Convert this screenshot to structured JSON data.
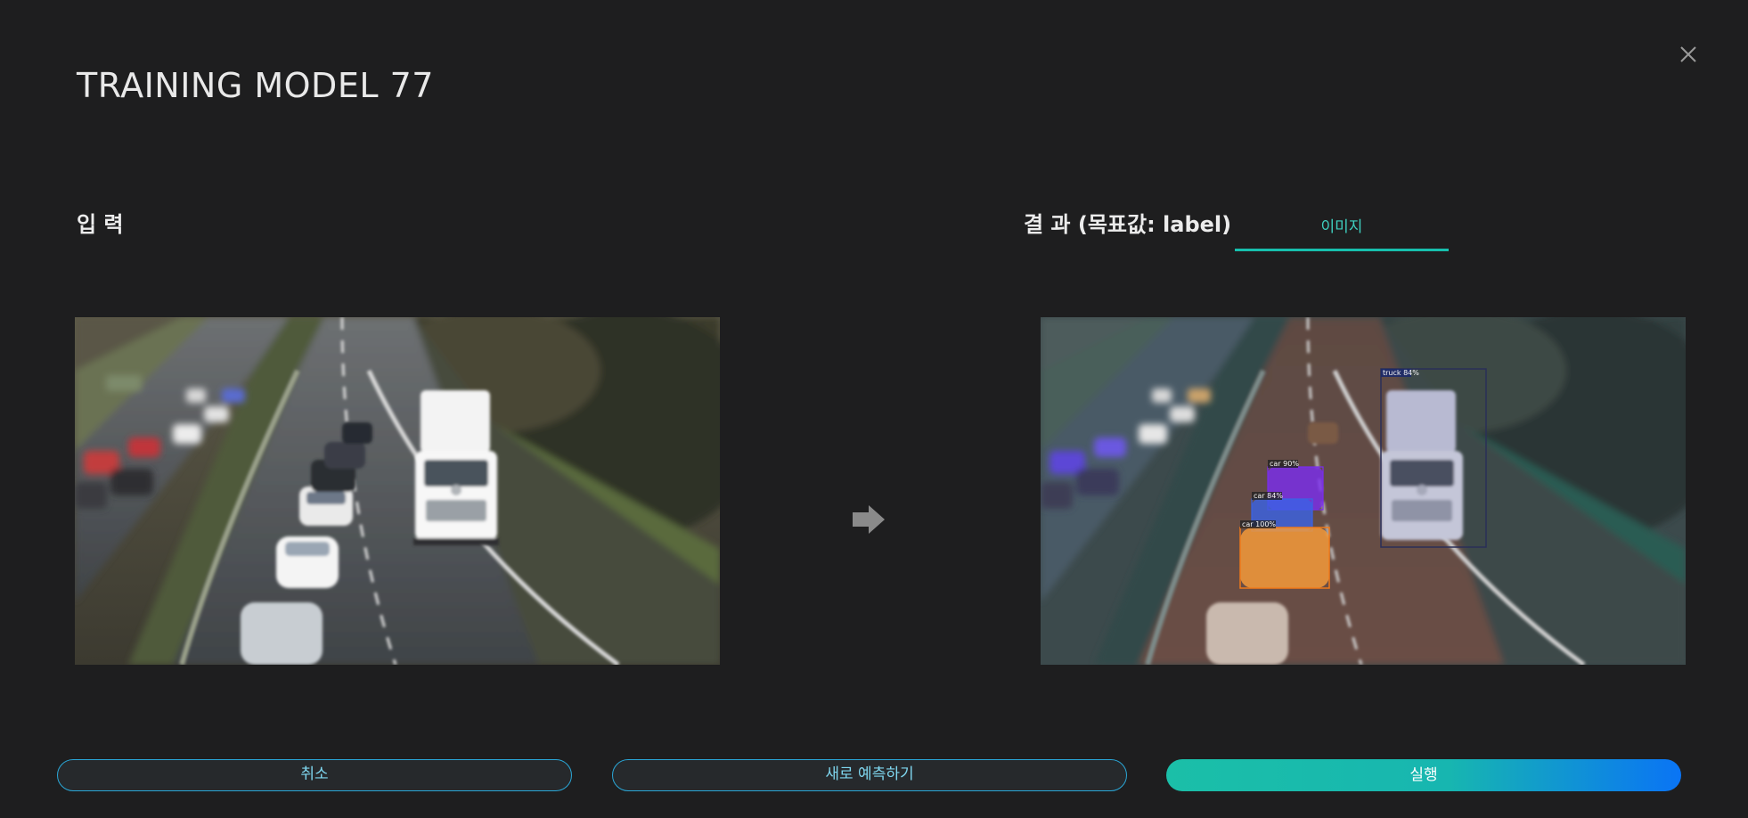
{
  "dialog": {
    "title": "TRAINING MODEL 77"
  },
  "input_section": {
    "label": "입 력"
  },
  "result_section": {
    "label": "결 과 (목표값: label)",
    "tabs": [
      {
        "label": "이미지",
        "active": true
      }
    ]
  },
  "detections": [
    {
      "label": "car 90%",
      "color": "#7b2df0"
    },
    {
      "label": "car 84%",
      "color": "#3a63e6"
    },
    {
      "label": "car 100%",
      "color": "#f59a3a"
    },
    {
      "label": "truck 84%",
      "color": "#8a90b0"
    }
  ],
  "buttons": {
    "cancel": "취소",
    "new_predict": "새로 예측하기",
    "run": "실행"
  },
  "colors": {
    "background": "#1e1e1f",
    "accent": "#17bfad",
    "outline_button_border": "#2aa6d6",
    "primary_gradient_end": "#0a74f5"
  },
  "icons": {
    "close": "close-icon",
    "arrow": "arrow-right-icon"
  }
}
